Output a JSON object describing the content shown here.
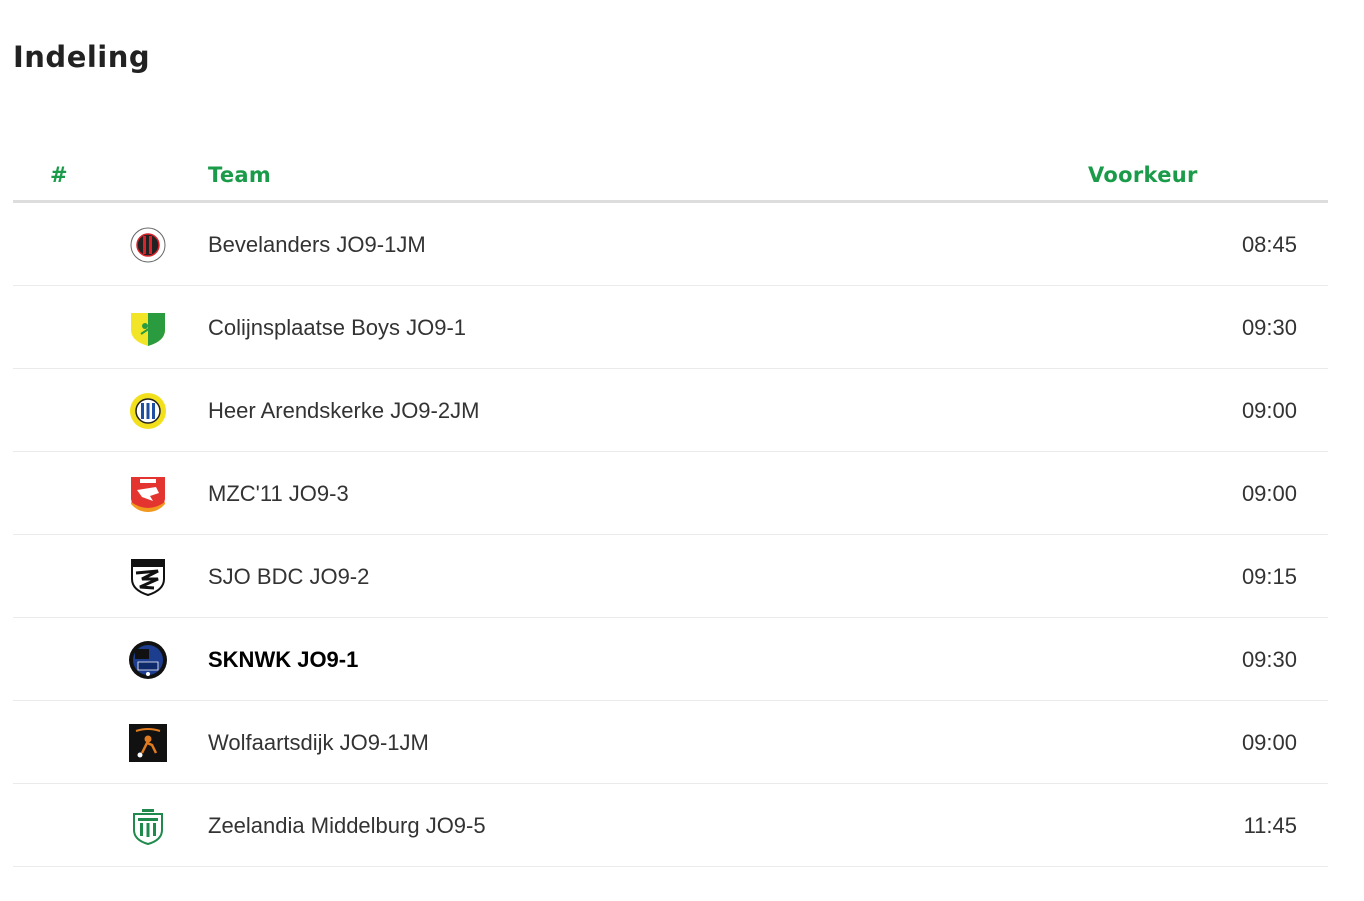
{
  "page": {
    "title": "Indeling"
  },
  "table": {
    "headers": {
      "rank": "#",
      "team": "Team",
      "preference": "Voorkeur"
    },
    "rows": [
      {
        "team": "Bevelanders JO9-1JM",
        "preference": "08:45",
        "logo": "bevelanders-logo",
        "own": false
      },
      {
        "team": "Colijnsplaatse Boys JO9-1",
        "preference": "09:30",
        "logo": "colijnsplaatse-boys-logo",
        "own": false
      },
      {
        "team": "Heer Arendskerke JO9-2JM",
        "preference": "09:00",
        "logo": "heer-arendskerke-logo",
        "own": false
      },
      {
        "team": "MZC'11 JO9-3",
        "preference": "09:00",
        "logo": "mzc11-logo",
        "own": false
      },
      {
        "team": "SJO BDC JO9-2",
        "preference": "09:15",
        "logo": "sjo-bdc-logo",
        "own": false
      },
      {
        "team": "SKNWK JO9-1",
        "preference": "09:30",
        "logo": "sknwk-logo",
        "own": true
      },
      {
        "team": "Wolfaartsdijk JO9-1JM",
        "preference": "09:00",
        "logo": "wolfaartsdijk-logo",
        "own": false
      },
      {
        "team": "Zeelandia Middelburg JO9-5",
        "preference": "11:45",
        "logo": "zeelandia-middelburg-logo",
        "own": false
      }
    ]
  },
  "colors": {
    "accent": "#1a9b49",
    "divider": "#dddddd",
    "row_border": "#ebebeb",
    "text": "#333333"
  }
}
